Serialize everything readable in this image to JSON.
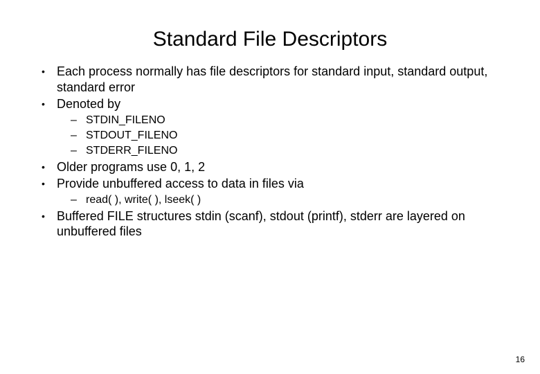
{
  "title": "Standard File Descriptors",
  "bullets": {
    "l1_0": "Each process normally has file descriptors for standard input, standard output, standard error",
    "l1_1": "Denoted by",
    "l2_0": "STDIN_FILENO",
    "l2_1": "STDOUT_FILENO",
    "l2_2": "STDERR_FILENO",
    "l1_2": "Older programs use 0, 1, 2",
    "l1_3": "Provide unbuffered access to data in files via",
    "l2_3": "read( ), write( ), lseek( )",
    "l1_4": "Buffered FILE structures stdin (scanf), stdout (printf), stderr are layered on unbuffered files"
  },
  "page_number": "16"
}
